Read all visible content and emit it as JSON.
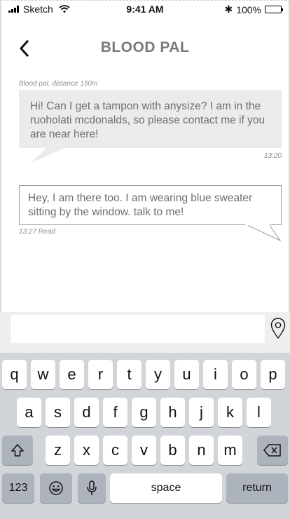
{
  "status_bar": {
    "carrier": "Sketch",
    "time": "9:41 AM",
    "battery": "100%",
    "bluetooth_symbol": "✱"
  },
  "header": {
    "title": "BLOOD PAL",
    "back_icon": "chevron-left-icon"
  },
  "chat": {
    "incoming": {
      "meta": "Blood pal, distance 150m",
      "text": "Hi! Can I get a tampon with anysize? I am in the ruoholati mcdonalds, so please contact me if you are near here!",
      "time": "13:20"
    },
    "outgoing": {
      "text": "Hey, I am there too. I am wearing blue sweater sitting by the window. talk to me!",
      "meta": "13:27 Read"
    }
  },
  "input": {
    "value": "",
    "placeholder": "",
    "location_icon": "map-pin-icon"
  },
  "keyboard": {
    "row1": [
      "q",
      "w",
      "e",
      "r",
      "t",
      "y",
      "u",
      "i",
      "o",
      "p"
    ],
    "row2": [
      "a",
      "s",
      "d",
      "f",
      "g",
      "h",
      "j",
      "k",
      "l"
    ],
    "row3": [
      "z",
      "x",
      "c",
      "v",
      "b",
      "n",
      "m"
    ],
    "numbers_label": "123",
    "space_label": "space",
    "return_label": "return"
  },
  "colors": {
    "title": "#7a7a7a",
    "incoming_bubble": "#ebebeb",
    "keyboard_bg": "#d1d4d9",
    "key_dark": "#adb3bc"
  }
}
